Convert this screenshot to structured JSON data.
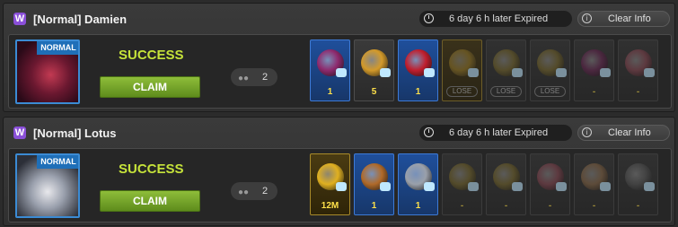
{
  "colors": {
    "accent_green": "#c6e33a",
    "claim_green": "#6f9e27",
    "badge_purple": "#8a4fd8",
    "tag_blue": "#1f6fb8"
  },
  "panels": [
    {
      "w_badge": "W",
      "title": "[Normal] Damien",
      "expire": "6 day 6 h later Expired",
      "clear": "Clear Info",
      "avatar_tag": "NORMAL",
      "status": "SUCCESS",
      "claim": "CLAIM",
      "party_count": "2",
      "slots": [
        {
          "style": "blue",
          "gem_color": "#8e2a6e",
          "count": "1",
          "lose": ""
        },
        {
          "style": "dark",
          "gem_color": "#d39a2a",
          "count": "5",
          "lose": ""
        },
        {
          "style": "blue",
          "gem_color": "#c01e2e",
          "count": "1",
          "lose": ""
        },
        {
          "style": "gold",
          "gem_color": "#9a7a20",
          "count": "",
          "lose": "LOSE"
        },
        {
          "style": "dark",
          "gem_color": "#7a6a30",
          "count": "",
          "lose": "LOSE"
        },
        {
          "style": "dark",
          "gem_color": "#7a6a30",
          "count": "",
          "lose": "LOSE"
        },
        {
          "style": "dark",
          "gem_color": "#6a2a55",
          "count": "-",
          "lose": ""
        },
        {
          "style": "dark",
          "gem_color": "#8a4a55",
          "count": "-",
          "lose": ""
        }
      ]
    },
    {
      "w_badge": "W",
      "title": "[Normal] Lotus",
      "expire": "6 day 6 h later Expired",
      "clear": "Clear Info",
      "avatar_tag": "NORMAL",
      "status": "SUCCESS",
      "claim": "CLAIM",
      "party_count": "2",
      "slots": [
        {
          "style": "gold",
          "gem_color": "#e0b020",
          "count": "12M",
          "lose": ""
        },
        {
          "style": "blue",
          "gem_color": "#b06a2a",
          "count": "1",
          "lose": ""
        },
        {
          "style": "blue",
          "gem_color": "#9aa0aa",
          "count": "1",
          "lose": ""
        },
        {
          "style": "dark",
          "gem_color": "#7a6a30",
          "count": "-",
          "lose": ""
        },
        {
          "style": "dark",
          "gem_color": "#7a6a30",
          "count": "-",
          "lose": ""
        },
        {
          "style": "dark",
          "gem_color": "#8a4a55",
          "count": "-",
          "lose": ""
        },
        {
          "style": "dark",
          "gem_color": "#8a6a4a",
          "count": "-",
          "lose": ""
        },
        {
          "style": "dark",
          "gem_color": "#5a5a5a",
          "count": "-",
          "lose": ""
        }
      ]
    }
  ]
}
